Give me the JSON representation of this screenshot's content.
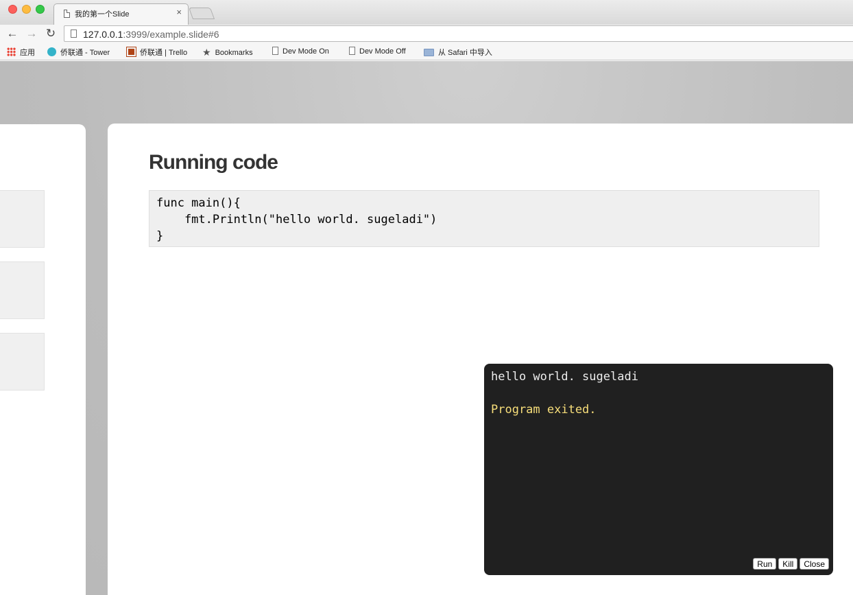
{
  "browser": {
    "tab_title": "我的第一个Slide",
    "tab_close": "×",
    "url_host": "127.0.0.1",
    "url_rest": ":3999/example.slide#6",
    "nav": {
      "back": "←",
      "forward": "→",
      "reload": "↻"
    },
    "bookmarks": [
      {
        "label": "应用",
        "icon": "apps-grid-icon"
      },
      {
        "label": "侨联通 - Tower",
        "icon": "tower-icon"
      },
      {
        "label": "侨联通 | Trello",
        "icon": "trello-icon"
      },
      {
        "label": "Bookmarks",
        "icon": "star-icon"
      },
      {
        "label": "Dev Mode On",
        "icon": "page-icon"
      },
      {
        "label": "Dev Mode Off",
        "icon": "page-icon"
      },
      {
        "label": "从 Safari 中导入",
        "icon": "folder-icon"
      }
    ]
  },
  "slide": {
    "title": "Running code",
    "code": [
      "func main(){",
      "    fmt.Println(\"hello world. sugeladi\")",
      "}"
    ]
  },
  "output": {
    "lines": [
      "hello world. sugeladi"
    ],
    "exit_message": "Program exited.",
    "buttons": {
      "run": "Run",
      "kill": "Kill",
      "close": "Close"
    }
  },
  "colors": {
    "output_bg": "#202020",
    "exit_text": "#f7de7a",
    "page_bg": "#bcbcbc"
  }
}
